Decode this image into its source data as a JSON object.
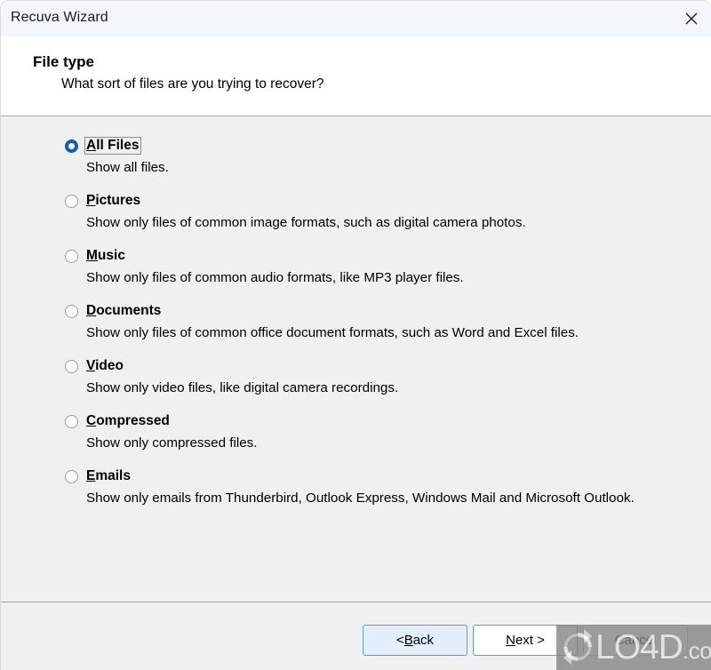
{
  "window": {
    "title": "Recuva Wizard",
    "close_icon": "close-icon"
  },
  "header": {
    "title": "File type",
    "subtitle": "What sort of files are you trying to recover?"
  },
  "options": [
    {
      "id": "all-files",
      "accel": "A",
      "rest": "ll Files",
      "label": "All Files",
      "description": "Show all files.",
      "selected": true,
      "focused": true
    },
    {
      "id": "pictures",
      "accel": "P",
      "rest": "ictures",
      "label": "Pictures",
      "description": "Show only files of common image formats, such as digital camera photos.",
      "selected": false,
      "focused": false
    },
    {
      "id": "music",
      "accel": "M",
      "rest": "usic",
      "label": "Music",
      "description": "Show only files of common audio formats, like MP3 player files.",
      "selected": false,
      "focused": false
    },
    {
      "id": "documents",
      "accel": "D",
      "rest": "ocuments",
      "label": "Documents",
      "description": "Show only files of common office document formats, such as Word and Excel files.",
      "selected": false,
      "focused": false
    },
    {
      "id": "video",
      "accel": "V",
      "rest": "ideo",
      "label": "Video",
      "description": "Show only video files, like digital camera recordings.",
      "selected": false,
      "focused": false
    },
    {
      "id": "compressed",
      "accel": "C",
      "rest": "ompressed",
      "label": "Compressed",
      "description": "Show only compressed files.",
      "selected": false,
      "focused": false
    },
    {
      "id": "emails",
      "accel": "E",
      "rest": "mails",
      "label": "Emails",
      "description": "Show only emails from Thunderbird, Outlook Express, Windows Mail and Microsoft Outlook.",
      "selected": false,
      "focused": false
    }
  ],
  "footer": {
    "back": {
      "prefix": "< ",
      "accel": "B",
      "suffix": "ack",
      "label": "< Back"
    },
    "next": {
      "prefix": "",
      "accel": "N",
      "suffix": "ext >",
      "label": "Next >"
    },
    "cancel": {
      "label": "Cancel"
    }
  },
  "watermark": {
    "name": "LO4D",
    "suffix": ".com",
    "logo_icon": "refresh-circular-arrows-icon"
  },
  "colors": {
    "accent_blue": "#0a5fb4",
    "button_border_blue": "#5a9fd4",
    "button_fill_blue": "#e2effb",
    "titlebar_bg": "#f3f6fa",
    "body_bg": "#f0f0f0",
    "header_bg": "#ffffff",
    "separator": "#a6a6a6"
  }
}
